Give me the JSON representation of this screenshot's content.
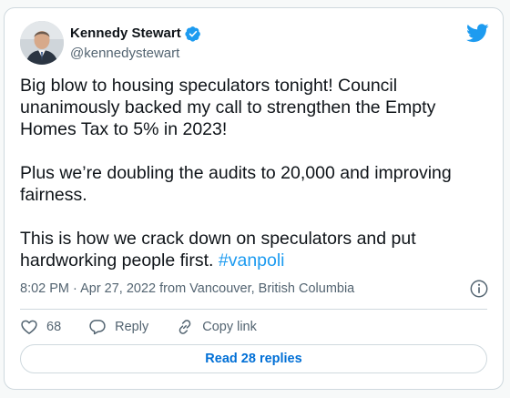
{
  "author": {
    "name": "Kennedy Stewart",
    "handle": "@kennedystewart",
    "verified": true
  },
  "tweet": {
    "paragraphs": [
      "Big blow to housing speculators tonight! Council unanimously backed my call to strengthen the Empty Homes Tax to 5% in 2023!",
      "Plus we’re doubling the audits to 20,000 and improving fairness.",
      "This is how we crack down on speculators and put hardworking people first."
    ],
    "hashtag": "#vanpoli",
    "meta": "8:02 PM · Apr 27, 2022 from Vancouver, British Columbia"
  },
  "actions": {
    "likes": "68",
    "reply_label": "Reply",
    "copy_label": "Copy link"
  },
  "read_replies_label": "Read 28 replies",
  "icons": {
    "brand": "twitter-bird-icon",
    "verified": "verified-badge-icon",
    "info": "info-icon",
    "like": "heart-icon",
    "reply": "reply-bubble-icon",
    "copy": "link-icon"
  },
  "colors": {
    "accent": "#1d9bf0",
    "button_text": "#006fd6",
    "muted": "#536471",
    "border": "#cfd9de"
  }
}
